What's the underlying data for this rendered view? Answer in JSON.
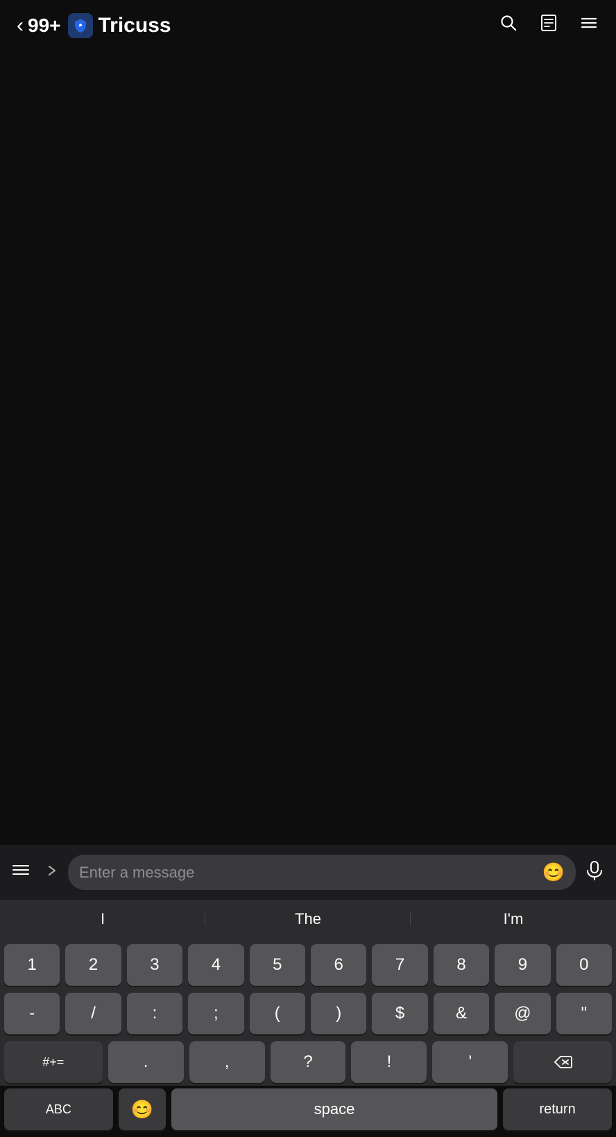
{
  "header": {
    "back_label": "<",
    "back_count": "99+",
    "channel_name": "Tricuss",
    "search_icon": "search",
    "notes_icon": "notes",
    "menu_icon": "menu"
  },
  "input_bar": {
    "menu_icon": "menu",
    "chevron_icon": ">",
    "placeholder": "Enter a message",
    "emoji_icon": "😊",
    "mic_icon": "mic"
  },
  "predictive": {
    "words": [
      "I",
      "The",
      "I'm"
    ]
  },
  "keyboard": {
    "row_numbers": [
      "1",
      "2",
      "3",
      "4",
      "5",
      "6",
      "7",
      "8",
      "9",
      "0"
    ],
    "row_symbols": [
      "-",
      "/",
      ":",
      ";",
      " ( ",
      " ) ",
      "$",
      "&",
      "@",
      "\""
    ],
    "row_misc": [
      "#+= ",
      ".",
      ",",
      "?",
      "!",
      "'",
      "⌫"
    ],
    "bottom": {
      "abc": "ABC",
      "space": "space",
      "return": "return"
    }
  }
}
